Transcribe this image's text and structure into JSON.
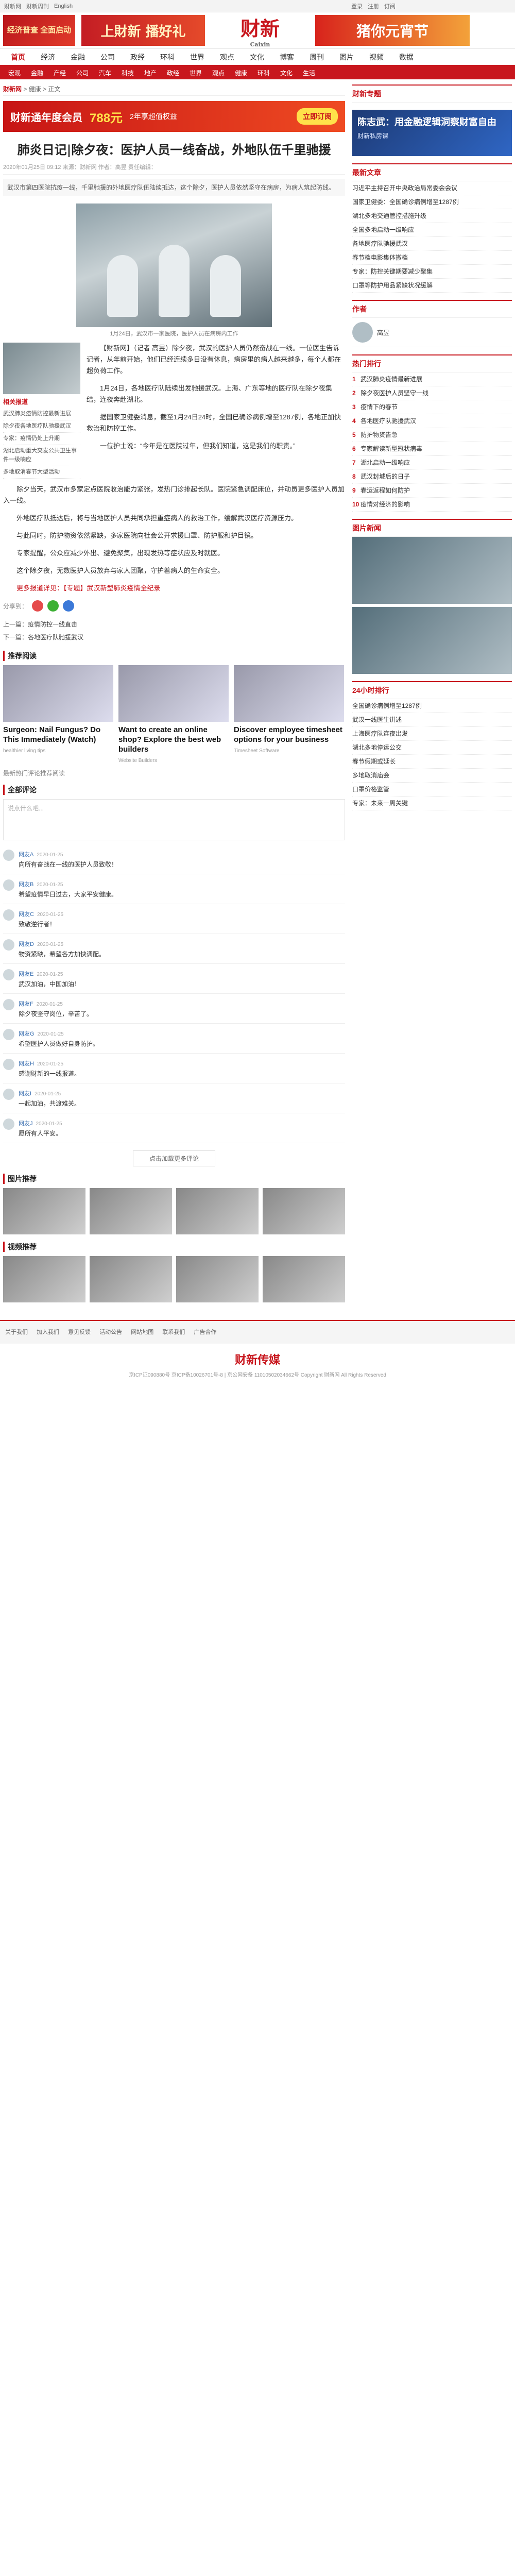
{
  "topbar": {
    "left": [
      "财新网",
      "财新周刊",
      "English"
    ],
    "right": [
      "登录",
      "注册",
      "订阅"
    ]
  },
  "ads": {
    "left": "经济普查 全面启动",
    "mid": "上財新 播好礼",
    "logo": "财新",
    "logo_sub": "Caixin",
    "right": "猪你元宵节"
  },
  "nav1": [
    "首页",
    "经济",
    "金融",
    "公司",
    "政经",
    "环科",
    "世界",
    "观点",
    "文化",
    "博客",
    "周刊",
    "图片",
    "视频",
    "数据"
  ],
  "nav2": [
    "宏观",
    "金融",
    "产经",
    "公司",
    "汽车",
    "科技",
    "地产",
    "政经",
    "世界",
    "观点",
    "健康",
    "环科",
    "文化",
    "生活"
  ],
  "breadcrumb": {
    "home": "财新网",
    "section": "健康",
    "sub": "正文"
  },
  "inad": {
    "title": "财新通年度会员",
    "price": "788元",
    "note": "2年享超值权益",
    "btn": "立即订阅"
  },
  "article": {
    "title": "肺炎日记|除夕夜：医护人员一线奋战，外地队伍千里驰援",
    "meta": "2020年01月25日 09:12  来源：财新网  作者：高昱  责任编辑：",
    "lead": "武汉市第四医院抗疫一线，千里驰援的外地医疗队伍陆续抵达，这个除夕，医护人员依然坚守在病房，为病人筑起防线。",
    "caption": "1月24日，武汉市一家医院，医护人员在病房内工作",
    "side_title": "相关报道",
    "side_links": [
      "武汉肺炎疫情防控最新进展",
      "除夕夜各地医疗队驰援武汉",
      "专家：疫情仍处上升期",
      "湖北启动重大突发公共卫生事件一级响应",
      "多地取消春节大型活动"
    ],
    "paras": [
      "【财新网】（记者 高昱）除夕夜，武汉的医护人员仍然奋战在一线。一位医生告诉记者，从年前开始，他们已经连续多日没有休息，病房里的病人越来越多，每个人都在超负荷工作。",
      "1月24日，各地医疗队陆续出发驰援武汉。上海、广东等地的医疗队在除夕夜集结，连夜奔赴湖北。",
      "据国家卫健委消息，截至1月24日24时，全国已确诊病例增至1287例，各地正加快救治和防控工作。",
      "一位护士说：“今年是在医院过年，但我们知道，这是我们的职责。”"
    ],
    "full": [
      "除夕当天，武汉市多家定点医院收治能力紧张，发热门诊排起长队。医院紧急调配床位，并动员更多医护人员加入一线。",
      "外地医疗队抵达后，将与当地医护人员共同承担重症病人的救治工作，缓解武汉医疗资源压力。",
      "与此同时，防护物资依然紧缺，多家医院向社会公开求援口罩、防护服和护目镜。",
      "专家提醒，公众应减少外出、避免聚集，出现发热等症状应及时就医。",
      "这个除夕夜，无数医护人员放弃与家人团聚，守护着病人的生命安全。"
    ],
    "more_label": "更多报道详见：【专题】武汉新型肺炎疫情全纪录"
  },
  "share": {
    "label": "分享到："
  },
  "prevnext": {
    "prev": "上一篇：疫情防控一线直击",
    "next": "下一篇：各地医疗队驰援武汉"
  },
  "sponsored": {
    "title": "推荐阅读",
    "cards": [
      {
        "title": "Surgeon: Nail Fungus? Do This Immediately (Watch)",
        "src": "healthier living tips"
      },
      {
        "title": "Want to create an online shop? Explore the best web builders",
        "src": "Website Builders"
      },
      {
        "title": "Discover employee timesheet options for your business",
        "src": "Timesheet Software"
      }
    ],
    "extra": "最新热门评论推荐阅读"
  },
  "comments": {
    "title": "全部评论",
    "placeholder": "说点什么吧...",
    "items": [
      {
        "user": "网友A",
        "time": "2020-01-25",
        "text": "向所有奋战在一线的医护人员致敬！"
      },
      {
        "user": "网友B",
        "time": "2020-01-25",
        "text": "希望疫情早日过去，大家平安健康。"
      },
      {
        "user": "网友C",
        "time": "2020-01-25",
        "text": "致敬逆行者！"
      },
      {
        "user": "网友D",
        "time": "2020-01-25",
        "text": "物资紧缺，希望各方加快调配。"
      },
      {
        "user": "网友E",
        "time": "2020-01-25",
        "text": "武汉加油，中国加油！"
      },
      {
        "user": "网友F",
        "time": "2020-01-25",
        "text": "除夕夜坚守岗位，辛苦了。"
      },
      {
        "user": "网友G",
        "time": "2020-01-25",
        "text": "希望医护人员做好自身防护。"
      },
      {
        "user": "网友H",
        "time": "2020-01-25",
        "text": "感谢财新的一线报道。"
      },
      {
        "user": "网友I",
        "time": "2020-01-25",
        "text": "一起加油，共渡难关。"
      },
      {
        "user": "网友J",
        "time": "2020-01-25",
        "text": "愿所有人平安。"
      }
    ],
    "more": "点击加载更多评论"
  },
  "pics": {
    "title": "图片推荐"
  },
  "videos": {
    "title": "视频推荐"
  },
  "footer": {
    "links": [
      "关于我们",
      "加入我们",
      "意见反馈",
      "活动公告",
      "网站地图",
      "联系我们",
      "广告合作"
    ],
    "logo": "财新传媒",
    "copy": "京ICP证090880号 京ICP备10026701号-8 | 京公网安备 11010502034662号 Copyright 财新网 All Rights Reserved"
  },
  "right": {
    "special_title": "财新专题",
    "adv_title": "陈志武：用金融逻辑洞察财富自由",
    "adv_sub": "财新私房课",
    "latest_title": "最新文章",
    "latest": [
      "习近平主持召开中央政治局常委会会议",
      "国家卫健委：全国确诊病例增至1287例",
      "湖北多地交通管控措施升级",
      "全国多地启动一级响应",
      "各地医疗队驰援武汉",
      "春节档电影集体撤档",
      "专家：防控关键期要减少聚集",
      "口罩等防护用品紧缺状况缓解"
    ],
    "author_title": "作者",
    "author_name": "高昱",
    "hot_title": "热门排行",
    "hot": [
      "武汉肺炎疫情最新进展",
      "除夕夜医护人员坚守一线",
      "疫情下的春节",
      "各地医疗队驰援武汉",
      "防护物资告急",
      "专家解读新型冠状病毒",
      "湖北启动一级响应",
      "武汉封城后的日子",
      "春运返程如何防护",
      "疫情对经济的影响"
    ],
    "photo_title": "图片新闻",
    "rank_title": "24小时排行",
    "rank": [
      "全国确诊病例增至1287例",
      "武汉一线医生讲述",
      "上海医疗队连夜出发",
      "湖北多地停运公交",
      "春节假期或延长",
      "多地取消庙会",
      "口罩价格监管",
      "专家：未来一周关键"
    ]
  }
}
